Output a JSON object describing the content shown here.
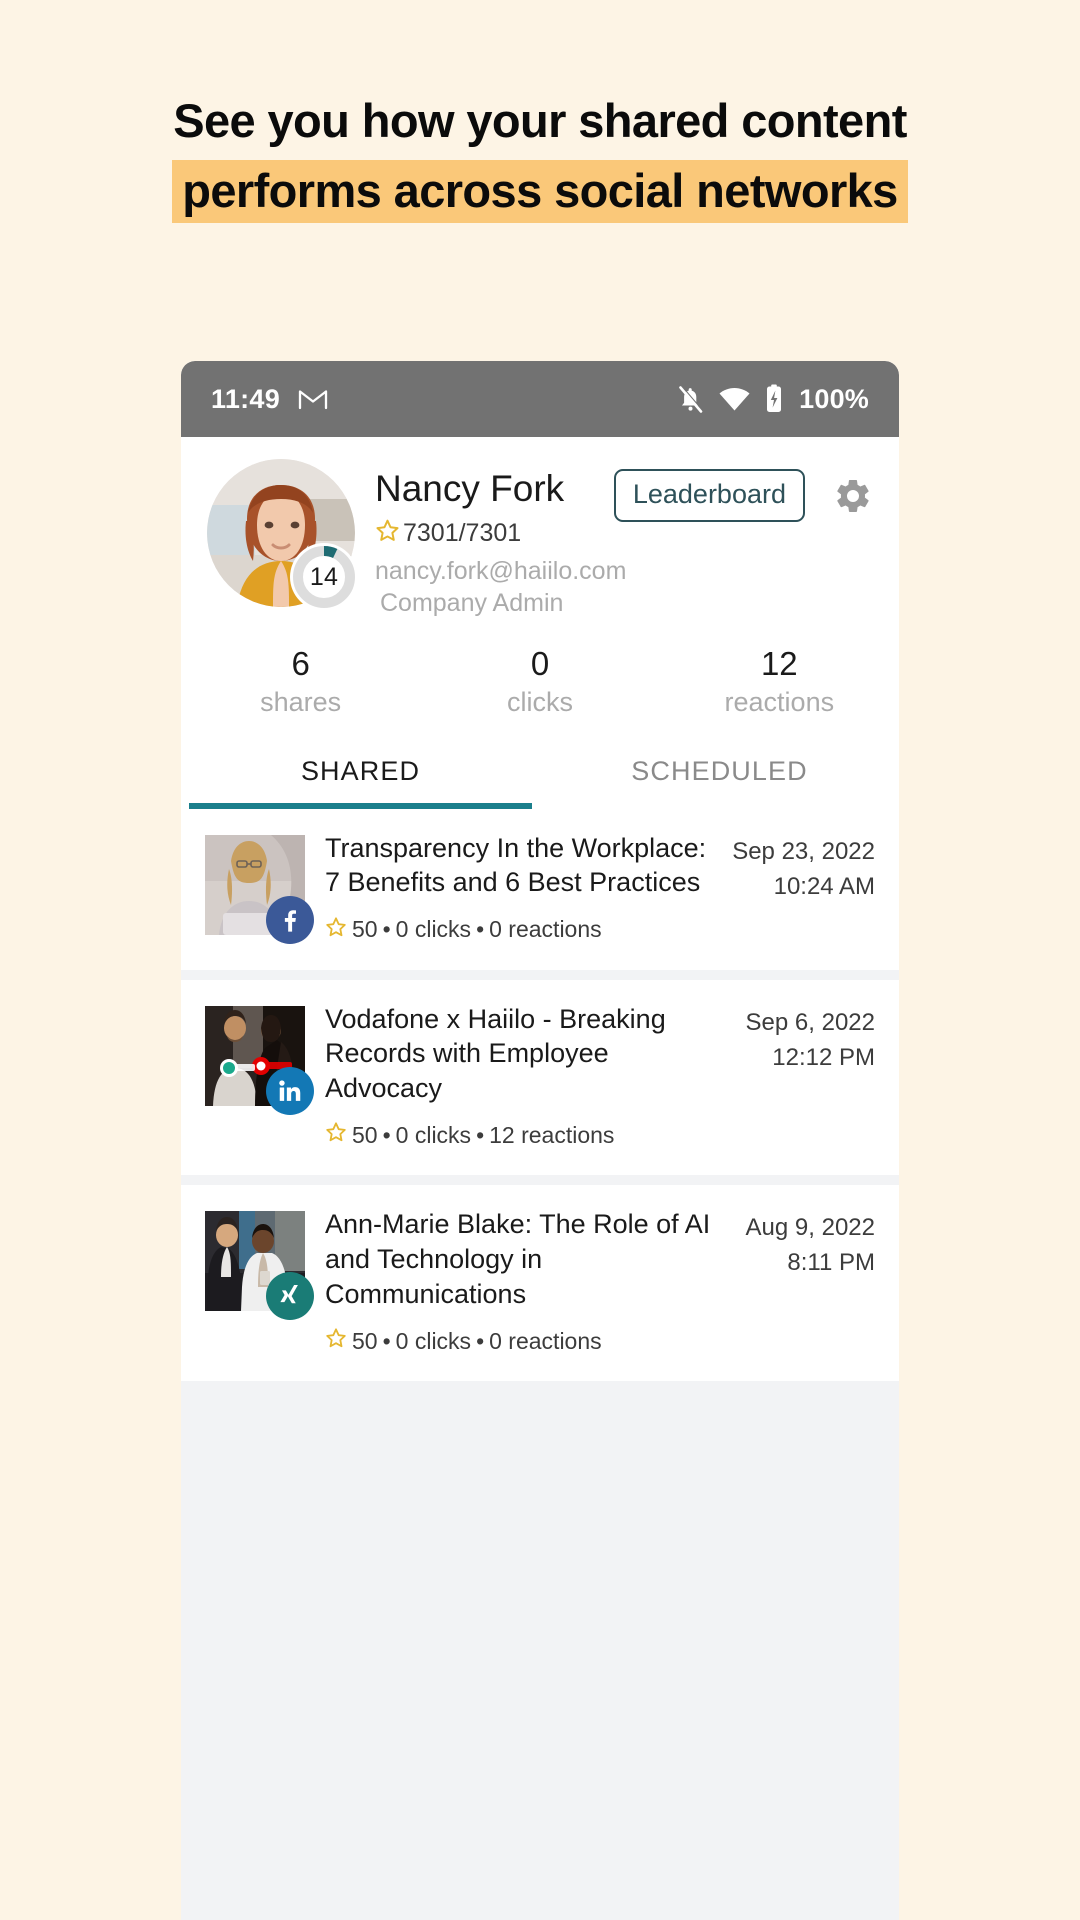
{
  "headline": {
    "line1": "See you how your shared content",
    "line2": "performs across social networks",
    "highlight_color": "#FAC879",
    "page_background": "#FDF4E5"
  },
  "phone": {
    "statusbar": {
      "time": "11:49",
      "app_icon": "gmail-icon",
      "notifications_icon": "bell-off-icon",
      "wifi_icon": "wifi-icon",
      "battery_icon": "battery-charging-icon",
      "battery_text": "100%",
      "background": "#727272"
    },
    "profile": {
      "avatar": "user-avatar",
      "level": "14",
      "name": "Nancy Fork",
      "points": "7301/7301",
      "points_icon": "star-icon",
      "email": "nancy.fork@haiilo.com",
      "role": "Company Admin",
      "leaderboard_label": "Leaderboard",
      "settings_icon": "gear-icon",
      "accent_color": "#2E5159"
    },
    "stats": [
      {
        "value": "6",
        "label": "shares"
      },
      {
        "value": "0",
        "label": "clicks"
      },
      {
        "value": "12",
        "label": "reactions"
      }
    ],
    "tabs": [
      {
        "label": "SHARED",
        "active": true
      },
      {
        "label": "SCHEDULED",
        "active": false
      }
    ],
    "tab_indicator_color": "#1B7F8C",
    "feed": [
      {
        "title": "Transparency In the Workplace: 7 Benefits and 6 Best Practices",
        "date": "Sep 23, 2022",
        "time": "10:24 AM",
        "points": "50",
        "clicks": "0 clicks",
        "reactions": "0 reactions",
        "separator": "•",
        "network": "facebook",
        "network_icon": "facebook-icon",
        "network_color": "#3B5998",
        "thumbnail": "woman-at-laptop-thumbnail"
      },
      {
        "title": "Vodafone x Haiilo - Breaking Records with Employee Advocacy",
        "date": "Sep 6, 2022",
        "time": "12:12 PM",
        "points": "50",
        "clicks": "0 clicks",
        "reactions": "12 reactions",
        "separator": "•",
        "network": "linkedin",
        "network_icon": "linkedin-icon",
        "network_color": "#1378B5",
        "thumbnail": "two-people-walking-thumbnail"
      },
      {
        "title": "Ann-Marie Blake: The Role of AI and Technology in Communications",
        "date": "Aug 9, 2022",
        "time": "8:11 PM",
        "points": "50",
        "clicks": "0 clicks",
        "reactions": "0 reactions",
        "separator": "•",
        "network": "xing",
        "network_icon": "xing-icon",
        "network_color": "#1A7C76",
        "thumbnail": "interview-thumbnail"
      }
    ]
  }
}
